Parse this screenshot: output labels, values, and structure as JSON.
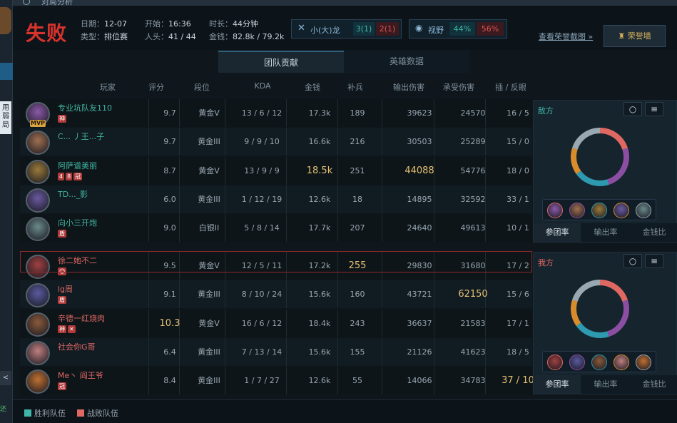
{
  "window": {
    "title": "对局分析"
  },
  "left_strip": {
    "side_text": "用弱局",
    "corner_glyph": "<",
    "bottom_text": "还选:"
  },
  "summary": {
    "result": "失败",
    "date_label": "日期：",
    "date": "12-07",
    "type_label": "类型：",
    "type": "排位赛",
    "start_label": "开始：",
    "start": "16:36",
    "kills_label": "人头：",
    "kills": "41 / 44",
    "duration_label": "时长：",
    "duration": "44分钟",
    "gold_label": "金钱：",
    "gold": "82.8k / 79.2k",
    "dragon": {
      "label": "小(大)龙",
      "blue": "3(1)",
      "red": "2(1)"
    },
    "vision": {
      "label": "视野",
      "blue": "44%",
      "red": "56%"
    },
    "screenshot_link": "查看荣誉截图 »",
    "honor_button": "荣誉墙"
  },
  "tabs": [
    {
      "label": "团队贡献",
      "active": true
    },
    {
      "label": "英雄数据",
      "active": false
    }
  ],
  "columns": [
    "玩家",
    "评分",
    "段位",
    "KDA",
    "金钱",
    "补兵",
    "输出伤害",
    "承受伤害",
    "插 / 反眼"
  ],
  "enemy_team": [
    {
      "name": "专业坑队友110",
      "score": "9.7",
      "rank": "黄金V",
      "kda": "13 / 6 / 12",
      "gold": "17.3k",
      "cs": "189",
      "dmg": "39623",
      "taken": "24570",
      "wards": "16 / 5",
      "badges": [
        "神"
      ],
      "mvp": "MVP",
      "color": "#8b5aa8"
    },
    {
      "name": "C... 丿王...子",
      "score": "9.7",
      "rank": "黄金III",
      "kda": "9 / 9 / 10",
      "gold": "16.6k",
      "cs": "216",
      "dmg": "30503",
      "taken": "25289",
      "wards": "15 / 0",
      "badges": [],
      "color": "#a07050"
    },
    {
      "name": "阿萨谱美丽",
      "score": "8.7",
      "rank": "黄金V",
      "kda": "13 / 9 / 9",
      "gold": "18.5k",
      "cs": "251",
      "dmg": "44088",
      "taken": "54776",
      "wards": "18 / 0",
      "badges": [
        "4",
        "8",
        "冠"
      ],
      "hl_gold": true,
      "hl_dmg": true,
      "color": "#9a7a3a"
    },
    {
      "name": "TD..._影",
      "score": "6.0",
      "rank": "黄金III",
      "kda": "1 / 12 / 19",
      "gold": "12.6k",
      "cs": "18",
      "dmg": "14895",
      "taken": "32592",
      "wards": "33 / 1",
      "badges": [],
      "color": "#6a5aa0"
    },
    {
      "name": "向小三开炮",
      "score": "9.0",
      "rank": "白银II",
      "kda": "5 / 8 / 14",
      "gold": "17.7k",
      "cs": "207",
      "dmg": "24640",
      "taken": "49613",
      "wards": "10 / 1",
      "badges": [
        "盾"
      ],
      "color": "#6a8a8a"
    }
  ],
  "ally_team": [
    {
      "name": "徐二她不二",
      "score": "9.5",
      "rank": "黄金V",
      "kda": "12 / 5 / 11",
      "gold": "17.2k",
      "cs": "255",
      "dmg": "29830",
      "taken": "31680",
      "wards": "17 / 2",
      "badges": [
        "☺"
      ],
      "hl_cs": true,
      "color": "#a04040"
    },
    {
      "name": "lg周",
      "score": "9.1",
      "rank": "黄金III",
      "kda": "8 / 10 / 24",
      "gold": "15.6k",
      "cs": "160",
      "dmg": "43721",
      "taken": "62150",
      "wards": "15 / 6",
      "badges": [
        "盾"
      ],
      "hl_taken": true,
      "color": "#5a5aa0"
    },
    {
      "name": "辛德一红烧肉",
      "score": "10.3",
      "rank": "黄金V",
      "kda": "16 / 6 / 12",
      "gold": "18.4k",
      "cs": "243",
      "dmg": "36637",
      "taken": "21583",
      "wards": "17 / 1",
      "badges": [
        "神",
        "✕"
      ],
      "hl_score": true,
      "hl_k": true,
      "color": "#8a5a3a"
    },
    {
      "name": "社会你G哥",
      "score": "6.4",
      "rank": "黄金III",
      "kda": "7 / 13 / 14",
      "gold": "15.6k",
      "cs": "155",
      "dmg": "21126",
      "taken": "41623",
      "wards": "18 / 5",
      "badges": [],
      "color": "#c08080"
    },
    {
      "name": "Me丶 阎王爷",
      "score": "8.4",
      "rank": "黄金III",
      "kda": "1 / 7 / 27",
      "gold": "12.6k",
      "cs": "55",
      "dmg": "14066",
      "taken": "34783",
      "wards": "37 / 10",
      "badges": [
        "冠"
      ],
      "hl_a": true,
      "hl_wards": true,
      "color": "#c07030"
    }
  ],
  "enemy_panel": {
    "label": "敌方",
    "colors": [
      "#e06863",
      "#8b4ea3",
      "#2e9ab0",
      "#d98c2b",
      "#9aa8b2"
    ],
    "shares": [
      0.2,
      0.25,
      0.2,
      0.15,
      0.2
    ],
    "tabs": [
      "参团率",
      "输出率",
      "金钱比"
    ]
  },
  "ally_panel": {
    "label": "我方",
    "colors": [
      "#e06863",
      "#8b4ea3",
      "#2e9ab0",
      "#d98c2b",
      "#9aa8b2"
    ],
    "shares": [
      0.2,
      0.25,
      0.2,
      0.15,
      0.2
    ],
    "tabs": [
      "参团率",
      "输出率",
      "金钱比"
    ]
  },
  "legend": {
    "win": "胜利队伍",
    "lose": "战败队伍",
    "win_color": "#3fb6a8",
    "lose_color": "#e06863"
  }
}
